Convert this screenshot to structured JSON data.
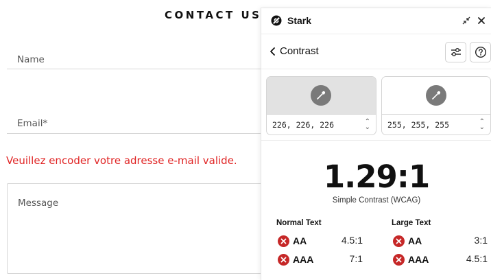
{
  "form": {
    "title": "CONTACT US",
    "name_label": "Name",
    "email_label": "Email*",
    "error": "Veuillez encoder votre adresse e-mail valide.",
    "message_label": "Message"
  },
  "panel": {
    "app_name": "Stark",
    "back_label": "Contrast",
    "colors": [
      {
        "swatch": "#e2e2e2",
        "value": "226, 226, 226"
      },
      {
        "swatch": "#ffffff",
        "value": "255, 255, 255"
      }
    ],
    "ratio": "1.29:1",
    "ratio_caption": "Simple Contrast (WCAG)",
    "normal_text": {
      "title": "Normal Text",
      "rows": [
        {
          "level": "AA",
          "required": "4.5:1",
          "status": "fail"
        },
        {
          "level": "AAA",
          "required": "7:1",
          "status": "fail"
        }
      ]
    },
    "large_text": {
      "title": "Large Text",
      "rows": [
        {
          "level": "AA",
          "required": "3:1",
          "status": "fail"
        },
        {
          "level": "AAA",
          "required": "4.5:1",
          "status": "fail"
        }
      ]
    },
    "accent_fail": "#c62828",
    "error_color": "#e02424"
  }
}
